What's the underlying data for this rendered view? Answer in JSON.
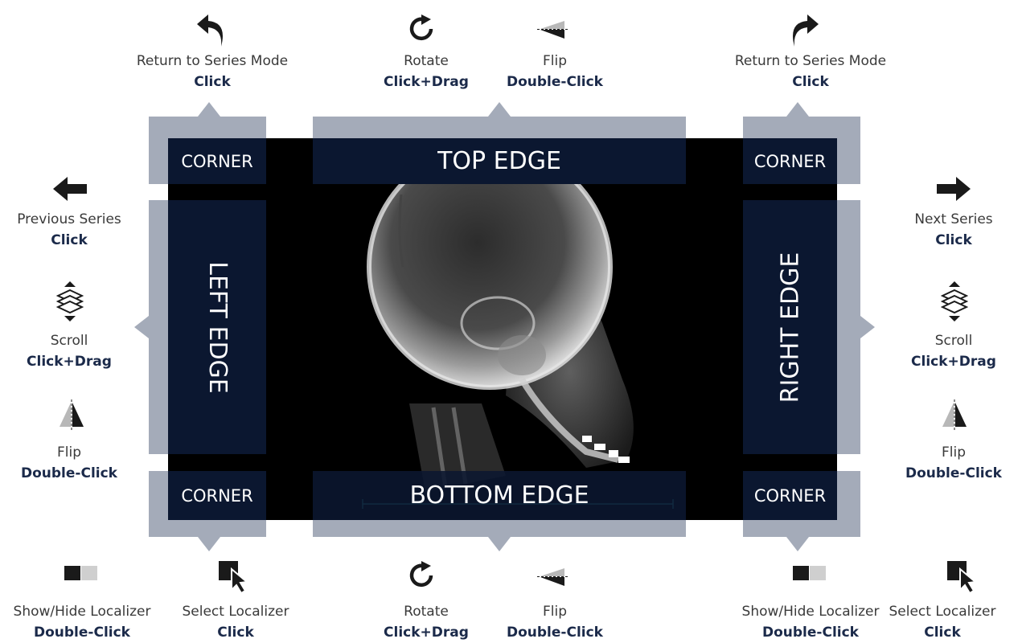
{
  "zones": {
    "top_left_corner": "CORNER",
    "top_edge": "TOP EDGE",
    "top_right_corner": "CORNER",
    "left_edge": "LEFT EDGE",
    "right_edge": "RIGHT EDGE",
    "bottom_left_corner": "CORNER",
    "bottom_edge": "BOTTOM EDGE",
    "bottom_right_corner": "CORNER"
  },
  "actions": {
    "top_left": {
      "action": "Return to Series Mode",
      "gesture": "Click",
      "icon": "curved-arrow-left-icon"
    },
    "top_rotate": {
      "action": "Rotate",
      "gesture": "Click+Drag",
      "icon": "rotate-icon"
    },
    "top_flip": {
      "action": "Flip",
      "gesture": "Double-Click",
      "icon": "flip-vertical-icon"
    },
    "top_right": {
      "action": "Return to Series Mode",
      "gesture": "Click",
      "icon": "curved-arrow-right-icon"
    },
    "left_prev": {
      "action": "Previous Series",
      "gesture": "Click",
      "icon": "arrow-left-icon"
    },
    "left_scroll": {
      "action": "Scroll",
      "gesture": "Click+Drag",
      "icon": "scroll-stack-icon"
    },
    "left_flip": {
      "action": "Flip",
      "gesture": "Double-Click",
      "icon": "flip-horizontal-icon"
    },
    "right_next": {
      "action": "Next Series",
      "gesture": "Click",
      "icon": "arrow-right-icon"
    },
    "right_scroll": {
      "action": "Scroll",
      "gesture": "Click+Drag",
      "icon": "scroll-stack-icon"
    },
    "right_flip": {
      "action": "Flip",
      "gesture": "Double-Click",
      "icon": "flip-horizontal-icon"
    },
    "bl_show_hide": {
      "action": "Show/Hide Localizer",
      "gesture": "Double-Click",
      "icon": "localizer-toggle-icon"
    },
    "bl_select": {
      "action": "Select Localizer",
      "gesture": "Click",
      "icon": "select-localizer-icon"
    },
    "bottom_rotate": {
      "action": "Rotate",
      "gesture": "Click+Drag",
      "icon": "rotate-icon"
    },
    "bottom_flip": {
      "action": "Flip",
      "gesture": "Double-Click",
      "icon": "flip-vertical-icon"
    },
    "br_show_hide": {
      "action": "Show/Hide Localizer",
      "gesture": "Double-Click",
      "icon": "localizer-toggle-icon"
    },
    "br_select": {
      "action": "Select Localizer",
      "gesture": "Click",
      "icon": "select-localizer-icon"
    }
  },
  "colors": {
    "frame": "#a4abb9",
    "zone": "#0b1730",
    "viewport": "#000000",
    "gesture_text": "#1b2a4a",
    "caption_text": "#3a3a3a",
    "scale_bar": "#3bb3b3"
  }
}
